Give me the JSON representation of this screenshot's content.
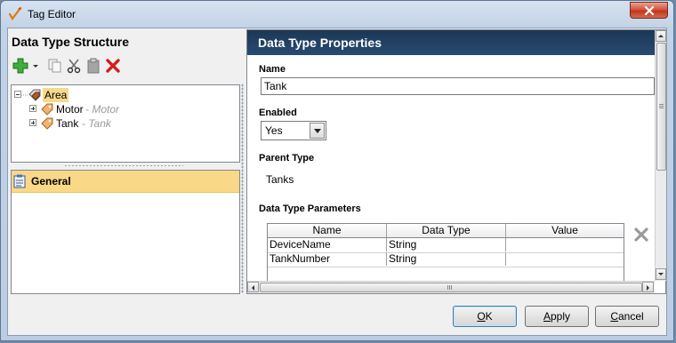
{
  "window": {
    "title": "Tag Editor",
    "close_icon": "close-icon"
  },
  "left_pane": {
    "title": "Data Type Structure",
    "toolbar": [
      {
        "name": "add-icon",
        "color": "#2e9e2e"
      },
      {
        "name": "dropdown-arrow-icon"
      },
      {
        "name": "copy-icon"
      },
      {
        "name": "cut-icon"
      },
      {
        "name": "paste-icon"
      },
      {
        "name": "delete-icon",
        "color": "#d21f1f"
      }
    ],
    "tree": {
      "root": {
        "label": "Area",
        "expanded": true
      },
      "children": [
        {
          "label": "Motor",
          "sublabel": "- Motor"
        },
        {
          "label": "Tank",
          "sublabel": "- Tank"
        }
      ]
    },
    "sections": [
      {
        "label": "General",
        "selected": true
      }
    ]
  },
  "properties": {
    "header": "Data Type Properties",
    "name_label": "Name",
    "name_value": "Tank",
    "enabled_label": "Enabled",
    "enabled_value": "Yes",
    "parent_type_label": "Parent Type",
    "parent_type_value": "Tanks",
    "params_label": "Data Type Parameters",
    "params_columns": [
      "Name",
      "Data Type",
      "Value"
    ],
    "params_rows": [
      [
        "DeviceName",
        "String",
        ""
      ],
      [
        "TankNumber",
        "String",
        ""
      ]
    ]
  },
  "buttons": {
    "ok": {
      "pre": "",
      "mnemonic": "O",
      "post": "K"
    },
    "apply": {
      "pre": "",
      "mnemonic": "A",
      "post": "pply"
    },
    "cancel": {
      "pre": "",
      "mnemonic": "C",
      "post": "ancel"
    }
  },
  "colors": {
    "header_bg": "#1c3756",
    "selection": "#f9d888"
  }
}
